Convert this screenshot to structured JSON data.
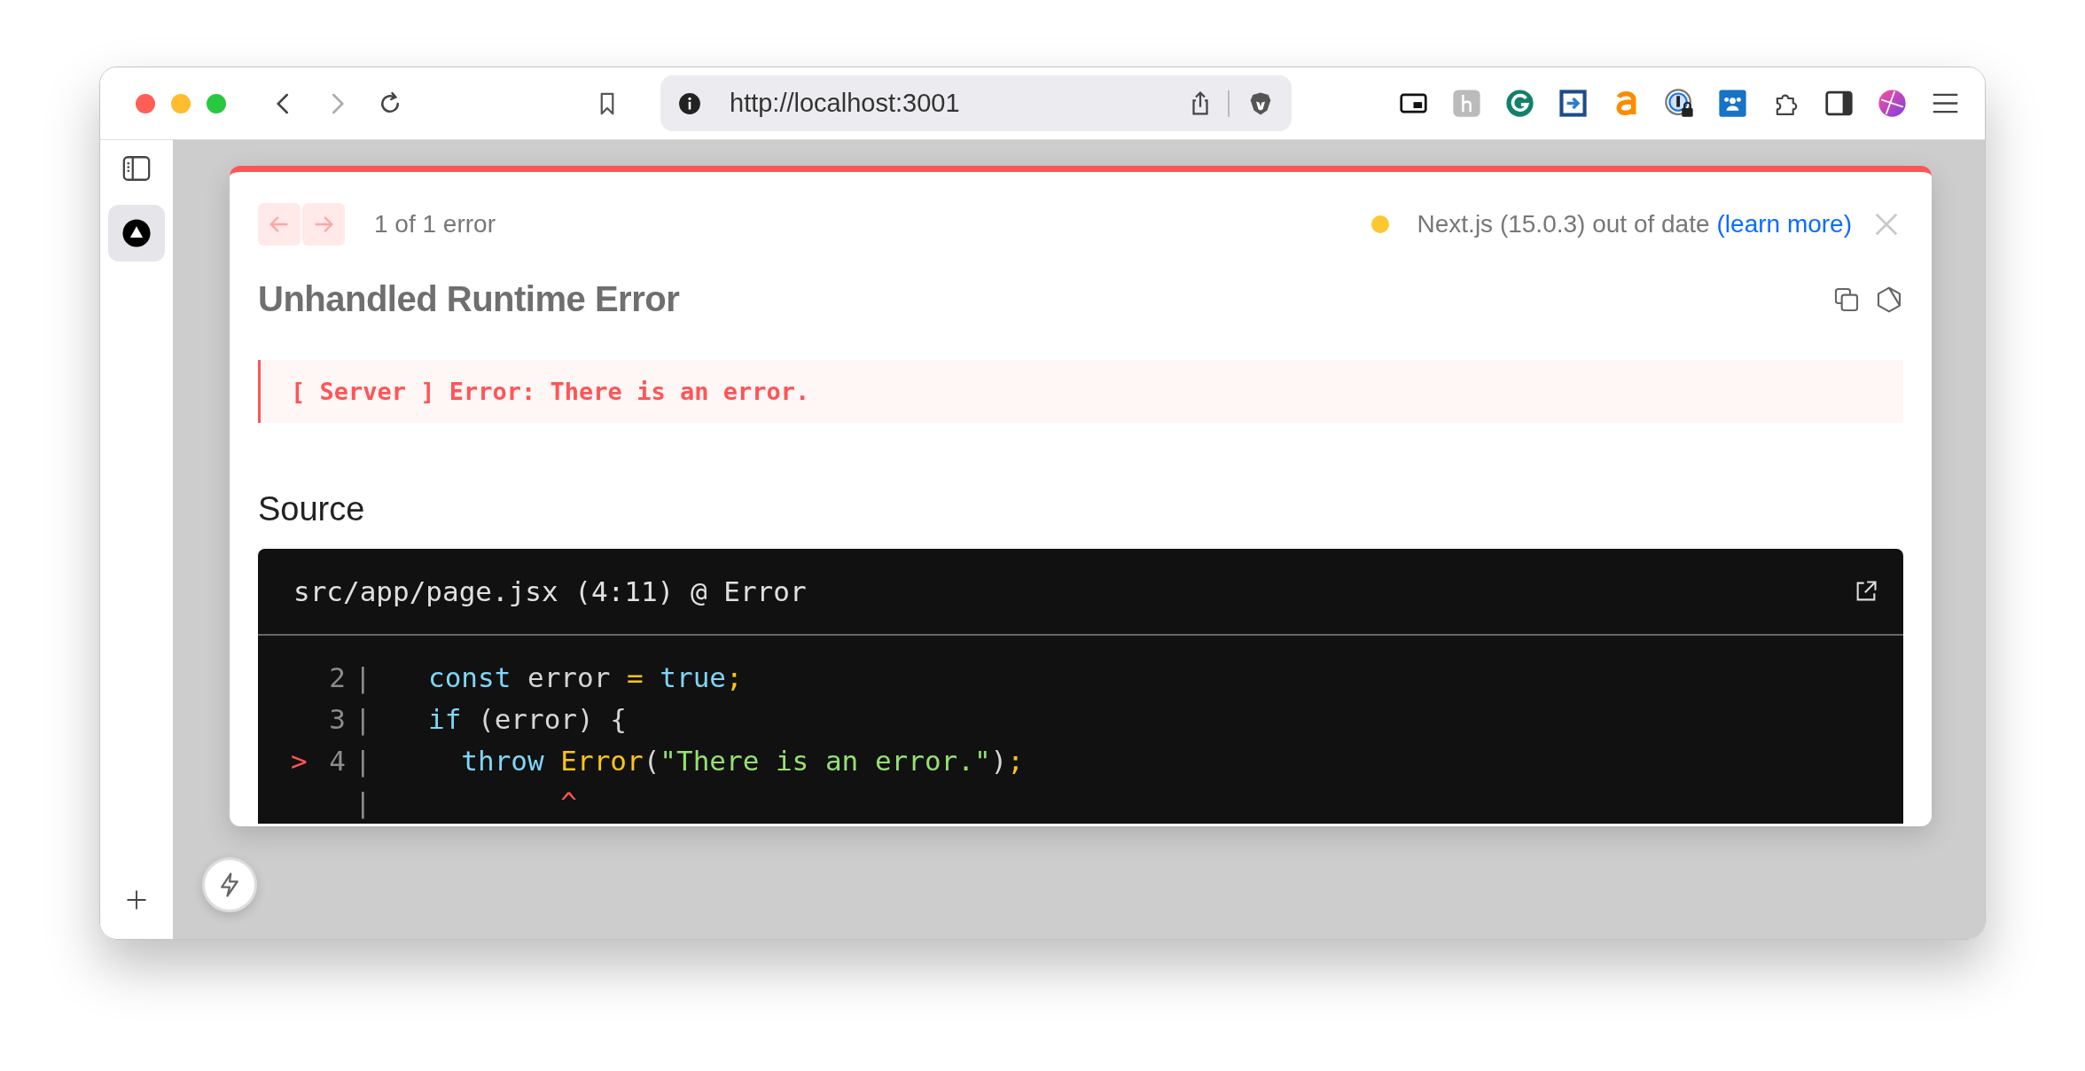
{
  "browser": {
    "url": "http://localhost:3001"
  },
  "overlay": {
    "pager": {
      "buttons": [
        {
          "kind": "prev",
          "disabled": true
        },
        {
          "kind": "next",
          "disabled": true
        }
      ],
      "label": "1 of 1 error"
    },
    "version_notice": {
      "text": "Next.js (15.0.3) out of date",
      "link": "(learn more)"
    },
    "title": "Unhandled Runtime Error",
    "message": "[ Server ] Error: There is an error.",
    "source": {
      "heading": "Source",
      "file": "src/app/page.jsx (4:11) @ Error",
      "lines": [
        {
          "number": "2",
          "gutter": "|",
          "tokens": [
            {
              "text": "const",
              "kind": "keyword"
            },
            {
              "text": " error ",
              "kind": "plain"
            },
            {
              "text": "=",
              "kind": "operator"
            },
            {
              "text": " true",
              "kind": "keyword"
            },
            {
              "text": ";",
              "kind": "operator"
            }
          ]
        },
        {
          "number": "3",
          "gutter": "|",
          "tokens": [
            {
              "text": "if",
              "kind": "keyword"
            },
            {
              "text": " (error) {",
              "kind": "plain"
            }
          ]
        },
        {
          "number": "4",
          "marker": ">",
          "gutter": "|",
          "tokens": [
            {
              "text": "  throw",
              "kind": "keyword"
            },
            {
              "text": " Error",
              "kind": "function"
            },
            {
              "text": "(",
              "kind": "plain"
            },
            {
              "text": "\"There is an error.\"",
              "kind": "string"
            },
            {
              "text": ")",
              "kind": "plain"
            },
            {
              "text": ";",
              "kind": "operator"
            }
          ]
        },
        {
          "gutter": "|",
          "tokens": [
            {
              "text": "        ^",
              "kind": "caret"
            }
          ]
        }
      ]
    }
  }
}
